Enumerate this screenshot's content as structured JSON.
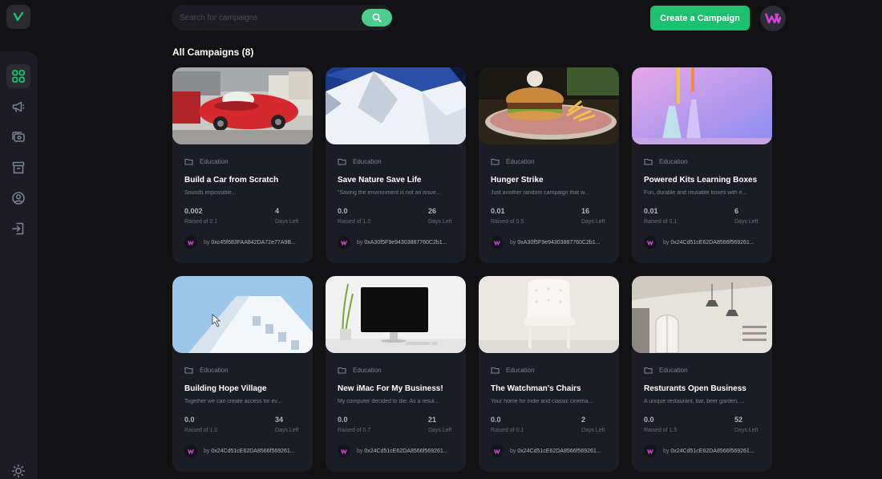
{
  "search": {
    "placeholder": "Search for campaigns"
  },
  "header": {
    "create_label": "Create a Campaign"
  },
  "section": {
    "title": "All Campaigns (8)"
  },
  "sidebar": {
    "items": [
      {
        "name": "dashboard",
        "icon": "grid-icon",
        "active": true
      },
      {
        "name": "campaign",
        "icon": "megaphone-icon"
      },
      {
        "name": "payment",
        "icon": "payment-icon"
      },
      {
        "name": "withdraw",
        "icon": "archive-icon"
      },
      {
        "name": "profile",
        "icon": "user-icon"
      },
      {
        "name": "logout",
        "icon": "logout-icon"
      }
    ],
    "theme_icon": "sun-icon"
  },
  "colors": {
    "accent": "#1dc071",
    "search_btn": "#4acd8d",
    "brand": "#8c6dfd"
  },
  "campaigns": [
    {
      "category": "Education",
      "title": "Build a Car from Scratch",
      "description": "Sounds impossible...",
      "raised": "0.002",
      "raised_label": "Raised of 0.1",
      "days": "4",
      "days_label": "Days Left",
      "by": "by",
      "owner": "0xc45f683FAA842DA72e77A9B..."
    },
    {
      "category": "Education",
      "title": "Save Nature Save Life",
      "description": "\"Saving the environment is not an issue...",
      "raised": "0.0",
      "raised_label": "Raised of 1.0",
      "days": "26",
      "days_label": "Days Left",
      "by": "by",
      "owner": "0xA30f5F9e94303887760C2b1..."
    },
    {
      "category": "Education",
      "title": "Hunger Strike",
      "description": "Just another random campaign that w...",
      "raised": "0.01",
      "raised_label": "Raised of 0.5",
      "days": "16",
      "days_label": "Days Left",
      "by": "by",
      "owner": "0xA30f5F9e94303887760C2b1..."
    },
    {
      "category": "Education",
      "title": "Powered Kits Learning Boxes",
      "description": "Fun, durable and reusable boxes with e...",
      "raised": "0.01",
      "raised_label": "Raised of 0.1",
      "days": "6",
      "days_label": "Days Left",
      "by": "by",
      "owner": "0x24Cd51cE62DA8566f569261..."
    },
    {
      "category": "Education",
      "title": "Building Hope Village",
      "description": "Together we can create access for ev...",
      "raised": "0.0",
      "raised_label": "Raised of 1.0",
      "days": "34",
      "days_label": "Days Left",
      "by": "by",
      "owner": "0x24Cd51cE62DA8566f569261..."
    },
    {
      "category": "Education",
      "title": "New iMac For My Business!",
      "description": "My computer decided to die. As a resul...",
      "raised": "0.0",
      "raised_label": "Raised of 0.7",
      "days": "21",
      "days_label": "Days Left",
      "by": "by",
      "owner": "0x24Cd51cE62DA8566f569261..."
    },
    {
      "category": "Education",
      "title": "The Watchman's Chairs",
      "description": "Your home for indie and classic cinema...",
      "raised": "0.0",
      "raised_label": "Raised of 0.1",
      "days": "2",
      "days_label": "Days Left",
      "by": "by",
      "owner": "0x24Cd51cE62DA8566f569261..."
    },
    {
      "category": "Education",
      "title": "Resturants Open Business",
      "description": "A unique restaurant, bar, beer garden, ...",
      "raised": "0.0",
      "raised_label": "Raised of 1.5",
      "days": "52",
      "days_label": "Days Left",
      "by": "by",
      "owner": "0x24Cd51cE62DA8566f569261..."
    }
  ]
}
